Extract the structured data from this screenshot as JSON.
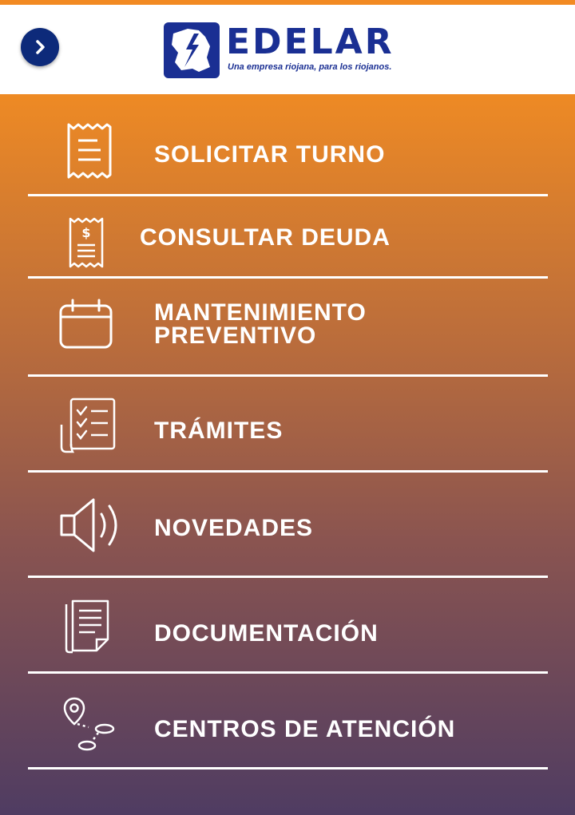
{
  "header": {
    "brand_name": "EDELAR",
    "tagline": "Una empresa riojana, para los riojanos.",
    "back_icon": "chevron-right-icon",
    "colors": {
      "accent": "#f28a22",
      "brand": "#1a2f93"
    }
  },
  "menu": {
    "items": [
      {
        "label": "SOLICITAR TURNO",
        "icon": "receipt-icon"
      },
      {
        "label": "CONSULTAR DEUDA",
        "icon": "bill-icon"
      },
      {
        "label_line1": "MANTENIMIENTO",
        "label_line2": "PREVENTIVO",
        "icon": "calendar-icon"
      },
      {
        "label": "TRÁMITES",
        "icon": "checklist-icon"
      },
      {
        "label": "NOVEDADES",
        "icon": "speaker-icon"
      },
      {
        "label": "DOCUMENTACIÓN",
        "icon": "documents-icon"
      },
      {
        "label": "CENTROS DE ATENCIÓN",
        "icon": "route-pin-icon"
      }
    ]
  }
}
